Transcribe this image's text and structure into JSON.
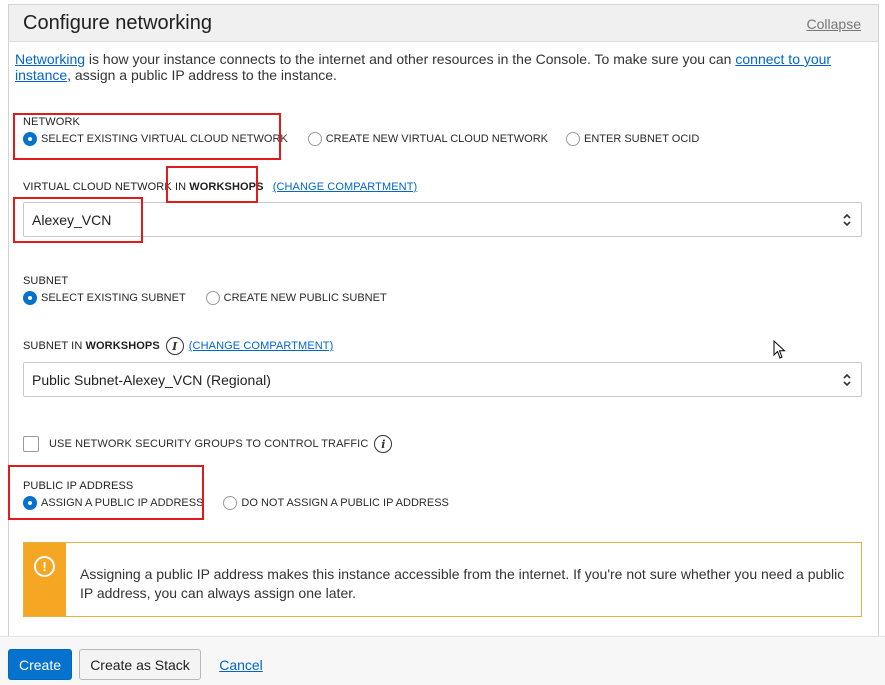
{
  "panel": {
    "title": "Configure networking",
    "collapse_label": "Collapse"
  },
  "intro": {
    "link1": "Networking",
    "text1": " is how your instance connects to the internet and other resources in the Console. To make sure you can ",
    "link2": "connect to your instance",
    "text2": ", assign a public IP address to the instance."
  },
  "network": {
    "label": "NETWORK",
    "options": [
      "SELECT EXISTING VIRTUAL CLOUD NETWORK",
      "CREATE NEW VIRTUAL CLOUD NETWORK",
      "ENTER SUBNET OCID"
    ],
    "selected": 0
  },
  "vcn": {
    "label_prefix": "VIRTUAL CLOUD NETWORK IN ",
    "compartment": "WORKSHOPS",
    "change_link": "(CHANGE COMPARTMENT)",
    "value": "Alexey_VCN"
  },
  "subnet": {
    "label": "SUBNET",
    "options": [
      "SELECT EXISTING SUBNET",
      "CREATE NEW PUBLIC SUBNET"
    ],
    "selected": 0
  },
  "subnet_select": {
    "label_prefix": "SUBNET IN ",
    "compartment": "WORKSHOPS",
    "change_link": "(CHANGE COMPARTMENT)",
    "value": "Public Subnet-Alexey_VCN (Regional)"
  },
  "nsg": {
    "label": "USE NETWORK SECURITY GROUPS TO CONTROL TRAFFIC",
    "checked": false
  },
  "public_ip": {
    "label": "PUBLIC IP ADDRESS",
    "options": [
      "ASSIGN A PUBLIC IP ADDRESS",
      "DO NOT ASSIGN A PUBLIC IP ADDRESS"
    ],
    "selected": 0
  },
  "warning": {
    "icon": "exclamation-icon",
    "text": "Assigning a public IP address makes this instance accessible from the internet. If you're not sure whether you need a public IP address, you can always assign one later.",
    "color": "#f5a623"
  },
  "footer": {
    "create": "Create",
    "create_stack": "Create as Stack",
    "cancel": "Cancel"
  },
  "colors": {
    "primary": "#0572ce",
    "highlight": "#e01b1b"
  }
}
